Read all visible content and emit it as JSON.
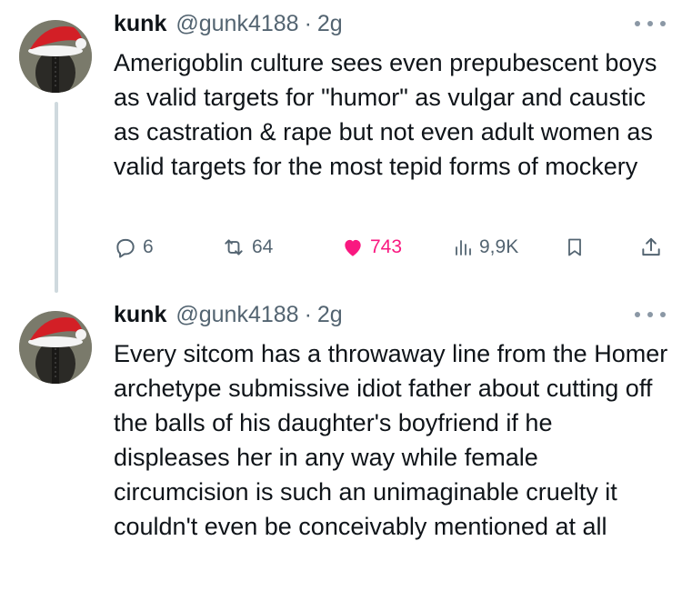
{
  "tweets": [
    {
      "name": "kunk",
      "handle": "@gunk4188",
      "separator": "·",
      "time": "2g",
      "text": "Amerigoblin culture sees even prepubescent boys as valid targets for \"humor\" as vulgar and caustic as castration & rape but not even adult women as valid targets for the most tepid forms of mockery",
      "actions": {
        "replies": "6",
        "retweets": "64",
        "likes": "743",
        "views": "9,9K"
      }
    },
    {
      "name": "kunk",
      "handle": "@gunk4188",
      "separator": "·",
      "time": "2g",
      "text": "Every sitcom has a throwaway line from the Homer archetype submissive idiot father about cutting off the balls of his daughter's boyfriend if he displeases her in any way while female circumcision is such an unimaginable cruelty it couldn't even be conceivably mentioned at all"
    }
  ],
  "colors": {
    "like": "#f91880",
    "muted": "#536471",
    "text": "#0f1419",
    "thread_line": "#cfd9de"
  },
  "icons": [
    "avatar-santa-hat",
    "more-icon",
    "reply-icon",
    "retweet-icon",
    "heart-icon",
    "views-icon",
    "bookmark-icon",
    "share-icon"
  ]
}
